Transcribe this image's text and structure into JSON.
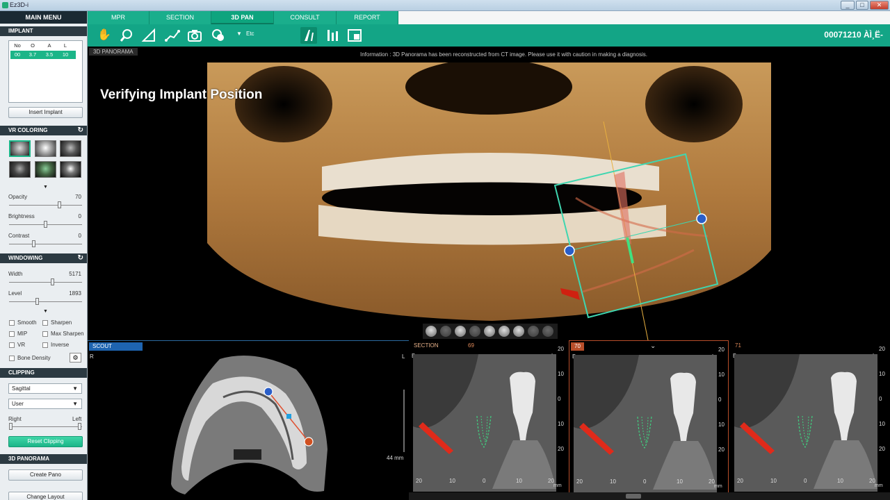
{
  "window": {
    "title": "Ez3D-i",
    "controls": [
      "_",
      "□",
      "✕"
    ]
  },
  "sidebar": {
    "main_menu": "MAIN MENU",
    "implant": {
      "header": "IMPLANT",
      "columns": [
        "No",
        "O",
        "A",
        "L"
      ],
      "row": [
        "00",
        "3.7",
        "3.5",
        "10"
      ],
      "insert_button": "Insert Implant"
    },
    "vr_coloring": {
      "header": "VR COLORING",
      "opacity_label": "Opacity",
      "opacity_value": "70",
      "opacity_level": 0.7,
      "brightness_label": "Brightness",
      "brightness_value": "0",
      "brightness_level": 0.5,
      "contrast_label": "Contrast",
      "contrast_value": "0",
      "contrast_level": 0.33
    },
    "windowing": {
      "header": "WINDOWING",
      "width_label": "Width",
      "width_value": "5171",
      "width_level": 0.6,
      "level_label": "Level",
      "level_value": "1893",
      "level_level": 0.38,
      "options": [
        "Smooth",
        "Sharpen",
        "MIP",
        "Max Sharpen",
        "VR",
        "Inverse",
        "Bone Density"
      ]
    },
    "clipping": {
      "header": "CLIPPING",
      "plane_select": "Sagittal",
      "mode_select": "User",
      "right_label": "Right",
      "left_label": "Left",
      "reset_button": "Reset Clipping"
    },
    "panorama": {
      "header": "3D PANORAMA",
      "create_button": "Create Pano",
      "layout_button": "Change Layout"
    }
  },
  "tabs": [
    "MPR",
    "SECTION",
    "3D PAN",
    "CONSULT",
    "REPORT"
  ],
  "active_tab": "3D PAN",
  "toolbar": {
    "tools": [
      "hand-icon",
      "zoom-icon",
      "angle-icon",
      "distance-icon",
      "camera-icon",
      "layers-icon"
    ],
    "etc_label": "Etc",
    "right_tools": [
      "implant-tool-icon",
      "implant-adjust-icon",
      "panel-icon"
    ],
    "patient_id": "00071210 ÀÌ¸Ë-"
  },
  "pano": {
    "tag": "3D PANORAMA",
    "info": "Information : 3D Panorama has been reconstructed from CT image. Please use it with caution in making a diagnosis.",
    "caption": "Verifying Implant Position"
  },
  "scout": {
    "tag": "SCOUT",
    "left_corner": "R",
    "right_corner": "L",
    "scale_label": "44 mm"
  },
  "sections": [
    {
      "tag": "SECTION",
      "number": "69",
      "top_left": "B",
      "top_right": "L"
    },
    {
      "tag": "",
      "number": "70",
      "top_left": "B",
      "top_right": "L"
    },
    {
      "tag": "",
      "number": "71",
      "top_left": "B",
      "top_right": "L"
    }
  ],
  "section_ruler": {
    "vertical": [
      "20",
      "10",
      "0",
      "10",
      "20"
    ],
    "horizontal": [
      "20",
      "10",
      "0",
      "10",
      "20"
    ],
    "unit": "mm"
  },
  "colors": {
    "accent": "#1bb588",
    "toolbar": "#13a586",
    "scout_tag": "#1e64b0",
    "section_active": "#b84e2a"
  }
}
